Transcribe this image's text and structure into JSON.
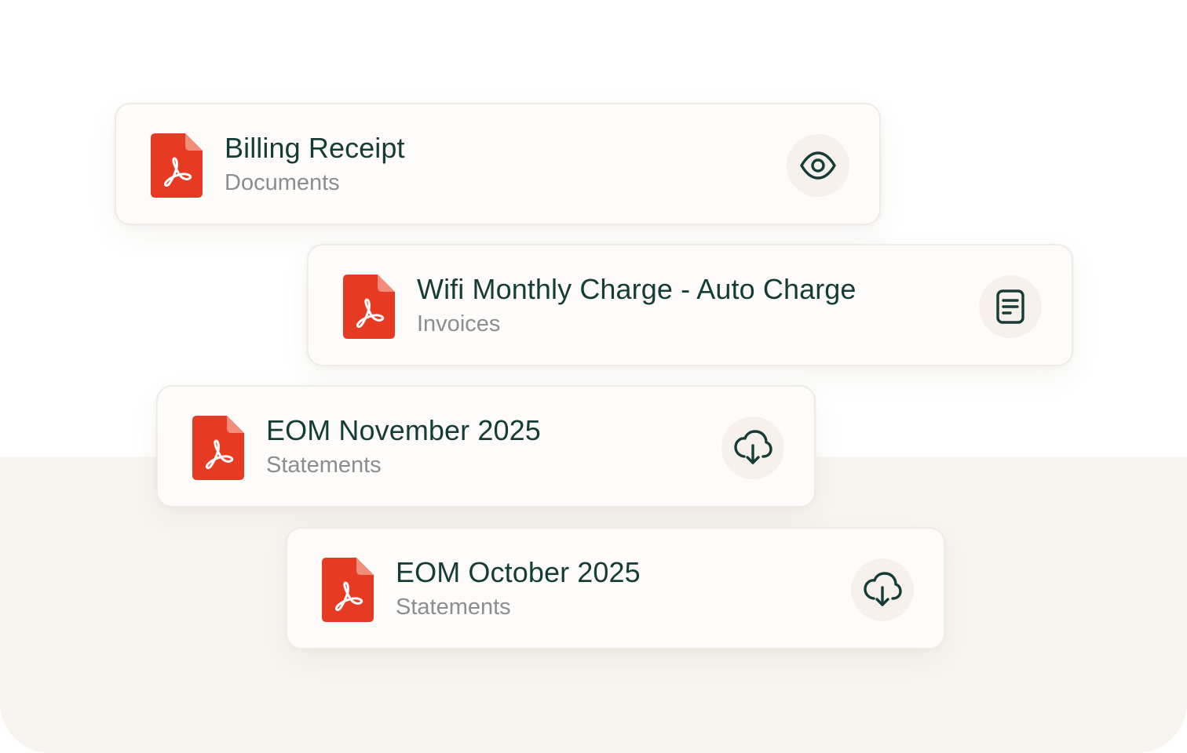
{
  "documents": [
    {
      "title": "Billing Receipt",
      "category": "Documents",
      "file_icon": "pdf-file-icon",
      "action_icon": "eye-icon",
      "action": "view"
    },
    {
      "title": "Wifi Monthly Charge - Auto Charge",
      "category": "Invoices",
      "file_icon": "pdf-file-icon",
      "action_icon": "document-icon",
      "action": "open-invoice"
    },
    {
      "title": "EOM November 2025",
      "category": "Statements",
      "file_icon": "pdf-file-icon",
      "action_icon": "cloud-download-icon",
      "action": "download"
    },
    {
      "title": "EOM October 2025",
      "category": "Statements",
      "file_icon": "pdf-file-icon",
      "action_icon": "cloud-download-icon",
      "action": "download"
    }
  ],
  "colors": {
    "pdf_red": "#e63a23",
    "pdf_fold": "#f28c7b",
    "title_text": "#163c36",
    "subtitle_text": "#8d8d8d",
    "icon_stroke": "#163c36",
    "card_bg": "#fdfcfb",
    "action_bg": "#f6f1ed",
    "panel_bg": "#f8f4f0"
  }
}
